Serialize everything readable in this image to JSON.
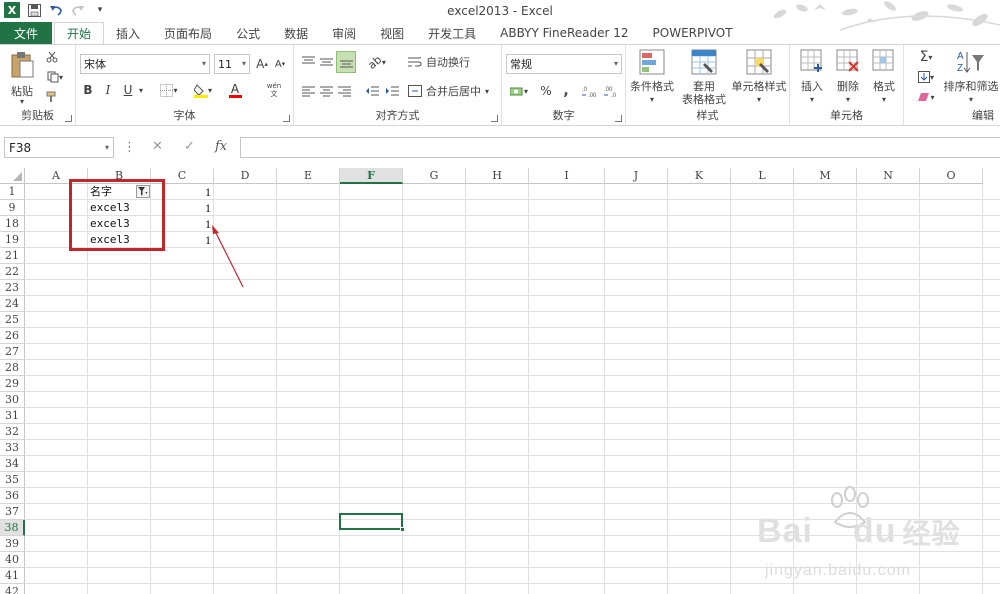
{
  "window": {
    "title": "excel2013 - Excel",
    "app_logo": "X"
  },
  "qat": {
    "icons": [
      "save-icon",
      "undo-icon",
      "redo-icon",
      "customize-icon"
    ]
  },
  "tabs": [
    {
      "label": "文件",
      "kind": "file"
    },
    {
      "label": "开始",
      "kind": "active"
    },
    {
      "label": "插入"
    },
    {
      "label": "页面布局"
    },
    {
      "label": "公式"
    },
    {
      "label": "数据"
    },
    {
      "label": "审阅"
    },
    {
      "label": "视图"
    },
    {
      "label": "开发工具"
    },
    {
      "label": "ABBYY FineReader 12"
    },
    {
      "label": "POWERPIVOT"
    }
  ],
  "ribbon": {
    "clipboard": {
      "label": "剪贴板",
      "paste": "粘贴"
    },
    "font": {
      "label": "字体",
      "font_name": "宋体",
      "font_size": "11",
      "bold": "B",
      "italic": "I",
      "underline": "U",
      "grow": "A",
      "shrink": "A",
      "font_color": "A",
      "phonetic": "wén\n文"
    },
    "alignment": {
      "label": "对齐方式",
      "wrap": "自动换行",
      "merge": "合并后居中"
    },
    "number": {
      "label": "数字",
      "format": "常规",
      "percent": "%",
      "comma": ","
    },
    "styles": {
      "label": "样式",
      "conditional": "条件格式",
      "table1": "套用",
      "table2": "表格格式",
      "cell_styles": "单元格样式"
    },
    "cells": {
      "label": "单元格",
      "insert": "插入",
      "delete": "删除",
      "format": "格式"
    },
    "editing": {
      "label": "编辑",
      "sort": "排序和筛选"
    }
  },
  "formula_bar": {
    "name_box": "F38",
    "fx": "fx",
    "cancel": "✕",
    "enter": "✓"
  },
  "grid": {
    "columns": [
      "A",
      "B",
      "C",
      "D",
      "E",
      "F",
      "G",
      "H",
      "I",
      "J",
      "K",
      "L",
      "M",
      "N",
      "O"
    ],
    "selected_column": "F",
    "rows": [
      "1",
      "9",
      "18",
      "19",
      "21",
      "22",
      "23",
      "24",
      "25",
      "26",
      "27",
      "28",
      "29",
      "30",
      "31",
      "32",
      "33",
      "34",
      "35",
      "36",
      "37",
      "38",
      "39",
      "40",
      "41",
      "42"
    ],
    "selected_row": "38",
    "cells": {
      "b1": "名字",
      "c1": "1",
      "b9": "excel3",
      "c9": "1",
      "b18": "excel3",
      "c18": "1",
      "b19": "excel3",
      "c19": "1"
    },
    "filter_icon": "filter-dropdown-icon"
  },
  "watermark": {
    "brand": "Bai",
    "brand2": "du",
    "cn": "经验",
    "url": "jingyan.baidu.com"
  },
  "colors": {
    "accent": "#217346",
    "annotation": "#c0262c"
  }
}
